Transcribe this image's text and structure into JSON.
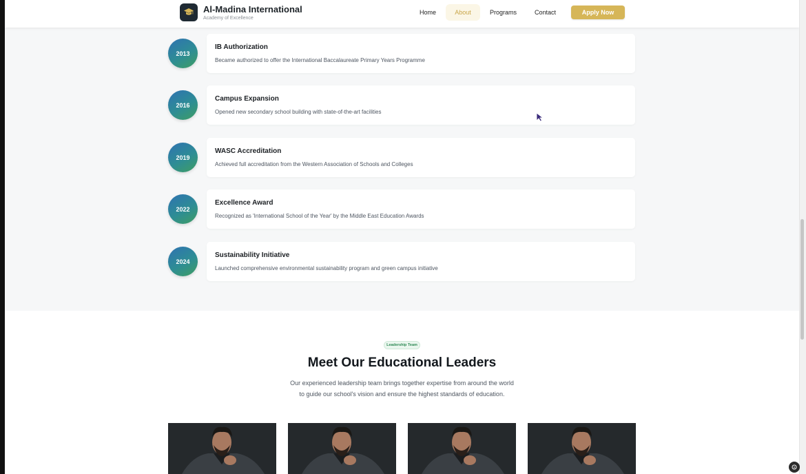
{
  "header": {
    "brand_title": "Al-Madina International",
    "brand_subtitle": "Academy of Excellence",
    "nav": [
      "Home",
      "About",
      "Programs",
      "Contact"
    ],
    "active_nav": "About",
    "cta_label": "Apply Now"
  },
  "timeline": [
    {
      "year": "2013",
      "title": "IB Authorization",
      "description": "Became authorized to offer the International Baccalaureate Primary Years Programme"
    },
    {
      "year": "2016",
      "title": "Campus Expansion",
      "description": "Opened new secondary school building with state-of-the-art facilities"
    },
    {
      "year": "2019",
      "title": "WASC Accreditation",
      "description": "Achieved full accreditation from the Western Association of Schools and Colleges"
    },
    {
      "year": "2022",
      "title": "Excellence Award",
      "description": "Recognized as 'International School of the Year' by the Middle East Education Awards"
    },
    {
      "year": "2024",
      "title": "Sustainability Initiative",
      "description": "Launched comprehensive environmental sustainability program and green campus initiative"
    }
  ],
  "leadership": {
    "badge": "Leadership Team",
    "heading": "Meet Our Educational Leaders",
    "description_line1": "Our experienced leadership team brings together expertise from around the world",
    "description_line2": "to guide our school's vision and ensure the highest standards of education."
  },
  "colors": {
    "accent_gold": "#d6b658",
    "timeline_gradient_start": "#2f72b2",
    "timeline_gradient_end": "#3f9d62",
    "badge_green": "#2f8a55"
  }
}
